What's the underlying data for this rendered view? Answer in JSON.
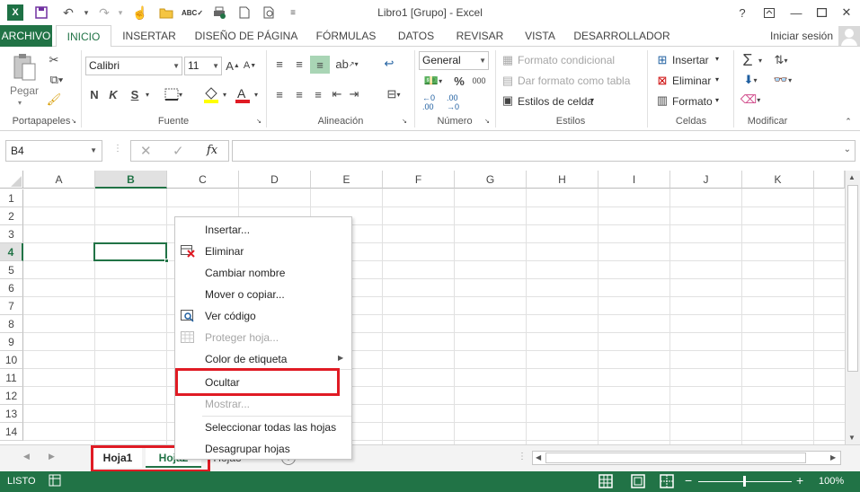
{
  "window": {
    "title": "Libro1  [Grupo] - Excel",
    "help": "?",
    "sign_in": "Iniciar sesión"
  },
  "tabs": [
    "ARCHIVO",
    "INICIO",
    "INSERTAR",
    "DISEÑO DE PÁGINA",
    "FÓRMULAS",
    "DATOS",
    "REVISAR",
    "VISTA",
    "DESARROLLADOR"
  ],
  "ribbon": {
    "clipboard": {
      "paste": "Pegar",
      "label": "Portapapeles"
    },
    "font": {
      "name": "Calibri",
      "size": "11",
      "bold": "N",
      "italic": "K",
      "underline": "S",
      "label": "Fuente"
    },
    "alignment": {
      "label": "Alineación"
    },
    "number": {
      "format": "General",
      "label": "Número",
      "percent": "%",
      "thousands": "000"
    },
    "styles": {
      "cond": "Formato condicional",
      "table": "Dar formato como tabla",
      "cell": "Estilos de celda",
      "label": "Estilos"
    },
    "cells": {
      "insert": "Insertar",
      "delete": "Eliminar",
      "format": "Formato",
      "label": "Celdas"
    },
    "edit": {
      "label": "Modificar"
    }
  },
  "formula_bar": {
    "name_box": "B4",
    "fx": "fx",
    "value": ""
  },
  "columns": [
    "A",
    "B",
    "C",
    "D",
    "E",
    "F",
    "G",
    "H",
    "I",
    "J",
    "K"
  ],
  "rows": [
    "1",
    "2",
    "3",
    "4",
    "5",
    "6",
    "7",
    "8",
    "9",
    "10",
    "11",
    "12",
    "13",
    "14"
  ],
  "selected_cell": "B4",
  "context_menu": [
    {
      "label": "Insertar...",
      "disabled": false
    },
    {
      "label": "Eliminar",
      "disabled": false
    },
    {
      "label": "Cambiar nombre",
      "disabled": false
    },
    {
      "label": "Mover o copiar...",
      "disabled": false
    },
    {
      "label": "Ver código",
      "disabled": false
    },
    {
      "label": "Proteger hoja...",
      "disabled": true
    },
    {
      "label": "Color de etiqueta",
      "disabled": false
    },
    {
      "label": "Ocultar",
      "disabled": false
    },
    {
      "label": "Mostrar...",
      "disabled": true
    },
    {
      "label": "Seleccionar todas las hojas",
      "disabled": false
    },
    {
      "label": "Desagrupar hojas",
      "disabled": false
    }
  ],
  "sheets": [
    "Hoja1",
    "Hoja2",
    "Hoja3"
  ],
  "status": {
    "mode": "LISTO",
    "zoom": "100%"
  },
  "colors": {
    "accent": "#217346",
    "highlight": "#e01b24"
  }
}
